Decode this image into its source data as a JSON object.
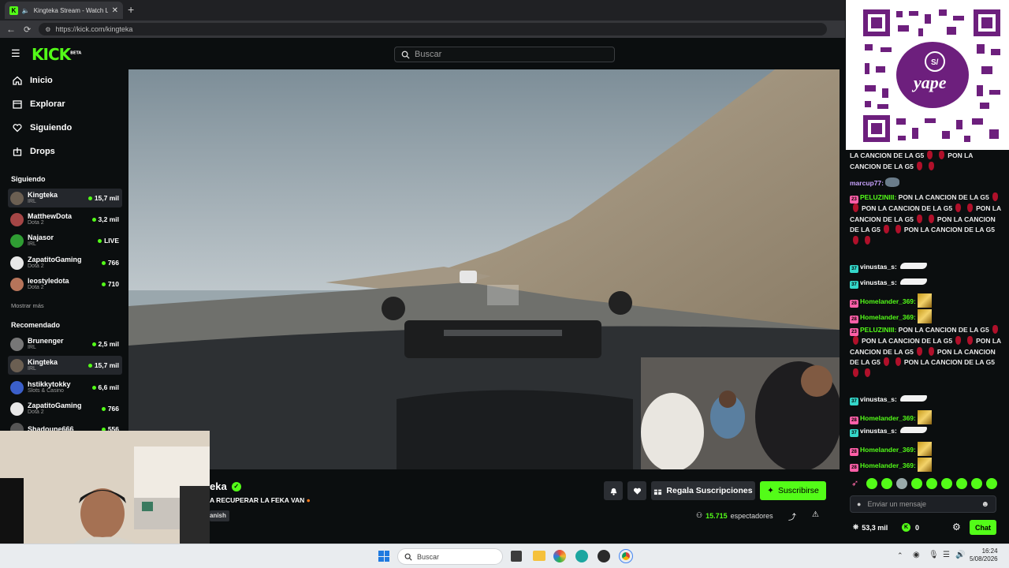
{
  "browser": {
    "tab_title": "Kingteka Stream - Watch Live",
    "url": "https://kick.com/kingteka",
    "new_tab": "+"
  },
  "header": {
    "logo": "KICK",
    "logo_tag": "BETA",
    "search_placeholder": "Buscar"
  },
  "sidebar": {
    "nav": [
      {
        "label": "Inicio",
        "icon": "home-icon"
      },
      {
        "label": "Explorar",
        "icon": "browse-icon"
      },
      {
        "label": "Siguiendo",
        "icon": "heart-icon"
      },
      {
        "label": "Drops",
        "icon": "drops-icon"
      }
    ],
    "following_title": "Siguiendo",
    "following": [
      {
        "name": "Kingteka",
        "category": "IRL",
        "viewers": "15,7 mil",
        "active": true
      },
      {
        "name": "MatthewDota",
        "category": "Dota 2",
        "viewers": "3,2 mil"
      },
      {
        "name": "Najasor",
        "category": "IRL",
        "viewers": "LIVE"
      },
      {
        "name": "ZapatitoGaming",
        "category": "Dota 2",
        "viewers": "766"
      },
      {
        "name": "leostyledota",
        "category": "Dota 2",
        "viewers": "710"
      }
    ],
    "show_more": "Mostrar más",
    "recommended_title": "Recomendado",
    "recommended": [
      {
        "name": "Brunenger",
        "category": "IRL",
        "viewers": "2,5 mil"
      },
      {
        "name": "Kingteka",
        "category": "IRL",
        "viewers": "15,7 mil",
        "active": true
      },
      {
        "name": "hstikkytokky",
        "category": "Slots & Casino",
        "viewers": "6,6 mil"
      },
      {
        "name": "ZapatitoGaming",
        "category": "Dota 2",
        "viewers": "766"
      },
      {
        "name": "Shadoune666",
        "category": "",
        "viewers": "556"
      }
    ]
  },
  "stream": {
    "channel_partial": "eka",
    "title_partial": "A RECUPERAR LA FEKA VAN",
    "tag_partial": "anish",
    "gift_label": "Regala Suscripciones",
    "subscribe_label": "Suscribirse",
    "viewers": "15.715",
    "viewers_label": "espectadores"
  },
  "chat": {
    "messages_top": [
      {
        "text": "LA CANCION DE LA G5",
        "tail": "PON LA"
      },
      {
        "text": "CANCION DE LA G5"
      }
    ],
    "marcup_user": "marcup77:",
    "peluzinii_user": "PELUZINIII:",
    "peluzinii_text": "PON LA CANCION DE LA G5",
    "vinustas_user": "vinustas_s:",
    "homelander_user": "Homelander_369:",
    "badge_37": "37",
    "badge_28": "28",
    "badge_23": "23",
    "input_placeholder": "Enviar un mensaje",
    "followers_count": "53,3 mil",
    "kick_count": "0",
    "chat_button": "Chat"
  },
  "taskbar": {
    "search_label": "Buscar",
    "time": "16:24",
    "date": "5/08/2026"
  },
  "colors": {
    "brand_green": "#53fc18",
    "background": "#0b0e0f"
  }
}
